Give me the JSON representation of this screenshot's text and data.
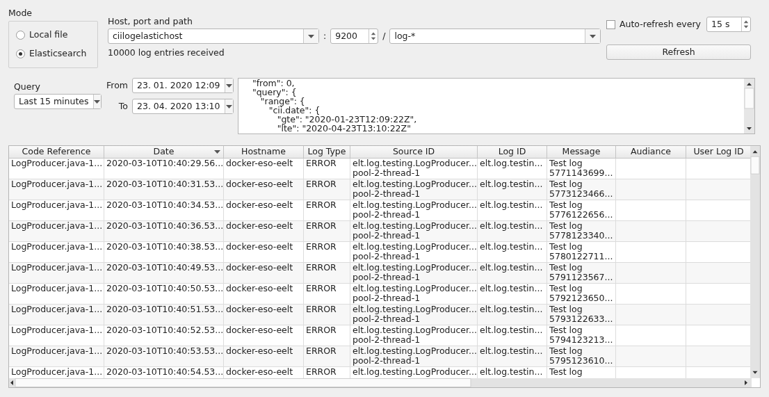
{
  "mode": {
    "label": "Mode",
    "options": [
      {
        "label": "Local file",
        "selected": false
      },
      {
        "label": "Elasticsearch",
        "selected": true
      }
    ]
  },
  "host": {
    "label": "Host, port and path",
    "host": "ciilogelastichost",
    "port_separator": ":",
    "port": "9200",
    "path_separator": "/",
    "path": "log-*",
    "status": "10000 log entries received"
  },
  "auto_refresh": {
    "label": "Auto-refresh every",
    "checked": false,
    "interval": "15 s"
  },
  "refresh_button": "Refresh",
  "query": {
    "label": "Query",
    "preset": "Last 15 minutes",
    "from_label": "From",
    "from": "23. 01. 2020 12:09",
    "to_label": "To",
    "to": "23. 04. 2020 13:10",
    "body": "    \"from\": 0,\n    \"query\": {\n       \"range\": {\n          \"cii.date\": {\n             \"gte\": \"2020-01-23T12:09:22Z\",\n             \"lte\": \"2020-04-23T13:10:22Z\""
  },
  "table": {
    "columns": [
      {
        "label": "Code Reference",
        "sorted": false
      },
      {
        "label": "Date",
        "sorted": true
      },
      {
        "label": "Hostname",
        "sorted": false
      },
      {
        "label": "Log Type",
        "sorted": false
      },
      {
        "label": "Source ID",
        "sorted": false
      },
      {
        "label": "Log ID",
        "sorted": false
      },
      {
        "label": "Message",
        "sorted": false
      },
      {
        "label": "Audiance",
        "sorted": false
      },
      {
        "label": "User Log ID",
        "sorted": false
      }
    ],
    "rows": [
      [
        "LogProducer.java-1...",
        "2020-03-10T10:40:29.56...",
        "docker-eso-eelt",
        "ERROR",
        "elt.log.testing.LogProducer...\npool-2-thread-1",
        "elt.log.testin...",
        "Test log\n5771143699..."
      ],
      [
        "LogProducer.java-1...",
        "2020-03-10T10:40:31.53...",
        "docker-eso-eelt",
        "ERROR",
        "elt.log.testing.LogProducer...\npool-2-thread-1",
        "elt.log.testin...",
        "Test log\n5773123466..."
      ],
      [
        "LogProducer.java-1...",
        "2020-03-10T10:40:34.53...",
        "docker-eso-eelt",
        "ERROR",
        "elt.log.testing.LogProducer...\npool-2-thread-1",
        "elt.log.testin...",
        "Test log\n5776122656..."
      ],
      [
        "LogProducer.java-1...",
        "2020-03-10T10:40:36.53...",
        "docker-eso-eelt",
        "ERROR",
        "elt.log.testing.LogProducer...\npool-2-thread-1",
        "elt.log.testin...",
        "Test log\n5778123340..."
      ],
      [
        "LogProducer.java-1...",
        "2020-03-10T10:40:38.53...",
        "docker-eso-eelt",
        "ERROR",
        "elt.log.testing.LogProducer...\npool-2-thread-1",
        "elt.log.testin...",
        "Test log\n5780122711..."
      ],
      [
        "LogProducer.java-1...",
        "2020-03-10T10:40:49.53...",
        "docker-eso-eelt",
        "ERROR",
        "elt.log.testing.LogProducer...\npool-2-thread-1",
        "elt.log.testin...",
        "Test log\n5791123567..."
      ],
      [
        "LogProducer.java-1...",
        "2020-03-10T10:40:50.53...",
        "docker-eso-eelt",
        "ERROR",
        "elt.log.testing.LogProducer...\npool-2-thread-1",
        "elt.log.testin...",
        "Test log\n5792123650..."
      ],
      [
        "LogProducer.java-1...",
        "2020-03-10T10:40:51.53...",
        "docker-eso-eelt",
        "ERROR",
        "elt.log.testing.LogProducer...\npool-2-thread-1",
        "elt.log.testin...",
        "Test log\n5793122633..."
      ],
      [
        "LogProducer.java-1...",
        "2020-03-10T10:40:52.53...",
        "docker-eso-eelt",
        "ERROR",
        "elt.log.testing.LogProducer...\npool-2-thread-1",
        "elt.log.testin...",
        "Test log\n5794123213..."
      ],
      [
        "LogProducer.java-1...",
        "2020-03-10T10:40:53.53...",
        "docker-eso-eelt",
        "ERROR",
        "elt.log.testing.LogProducer...\npool-2-thread-1",
        "elt.log.testin...",
        "Test log\n5795123610..."
      ],
      [
        "LogProducer.java-1...",
        "2020-03-10T10:40:54.53...",
        "docker-eso-eelt",
        "ERROR",
        "elt.log.testing.LogProducer...",
        "elt.log.testin...",
        "Test log"
      ]
    ]
  }
}
